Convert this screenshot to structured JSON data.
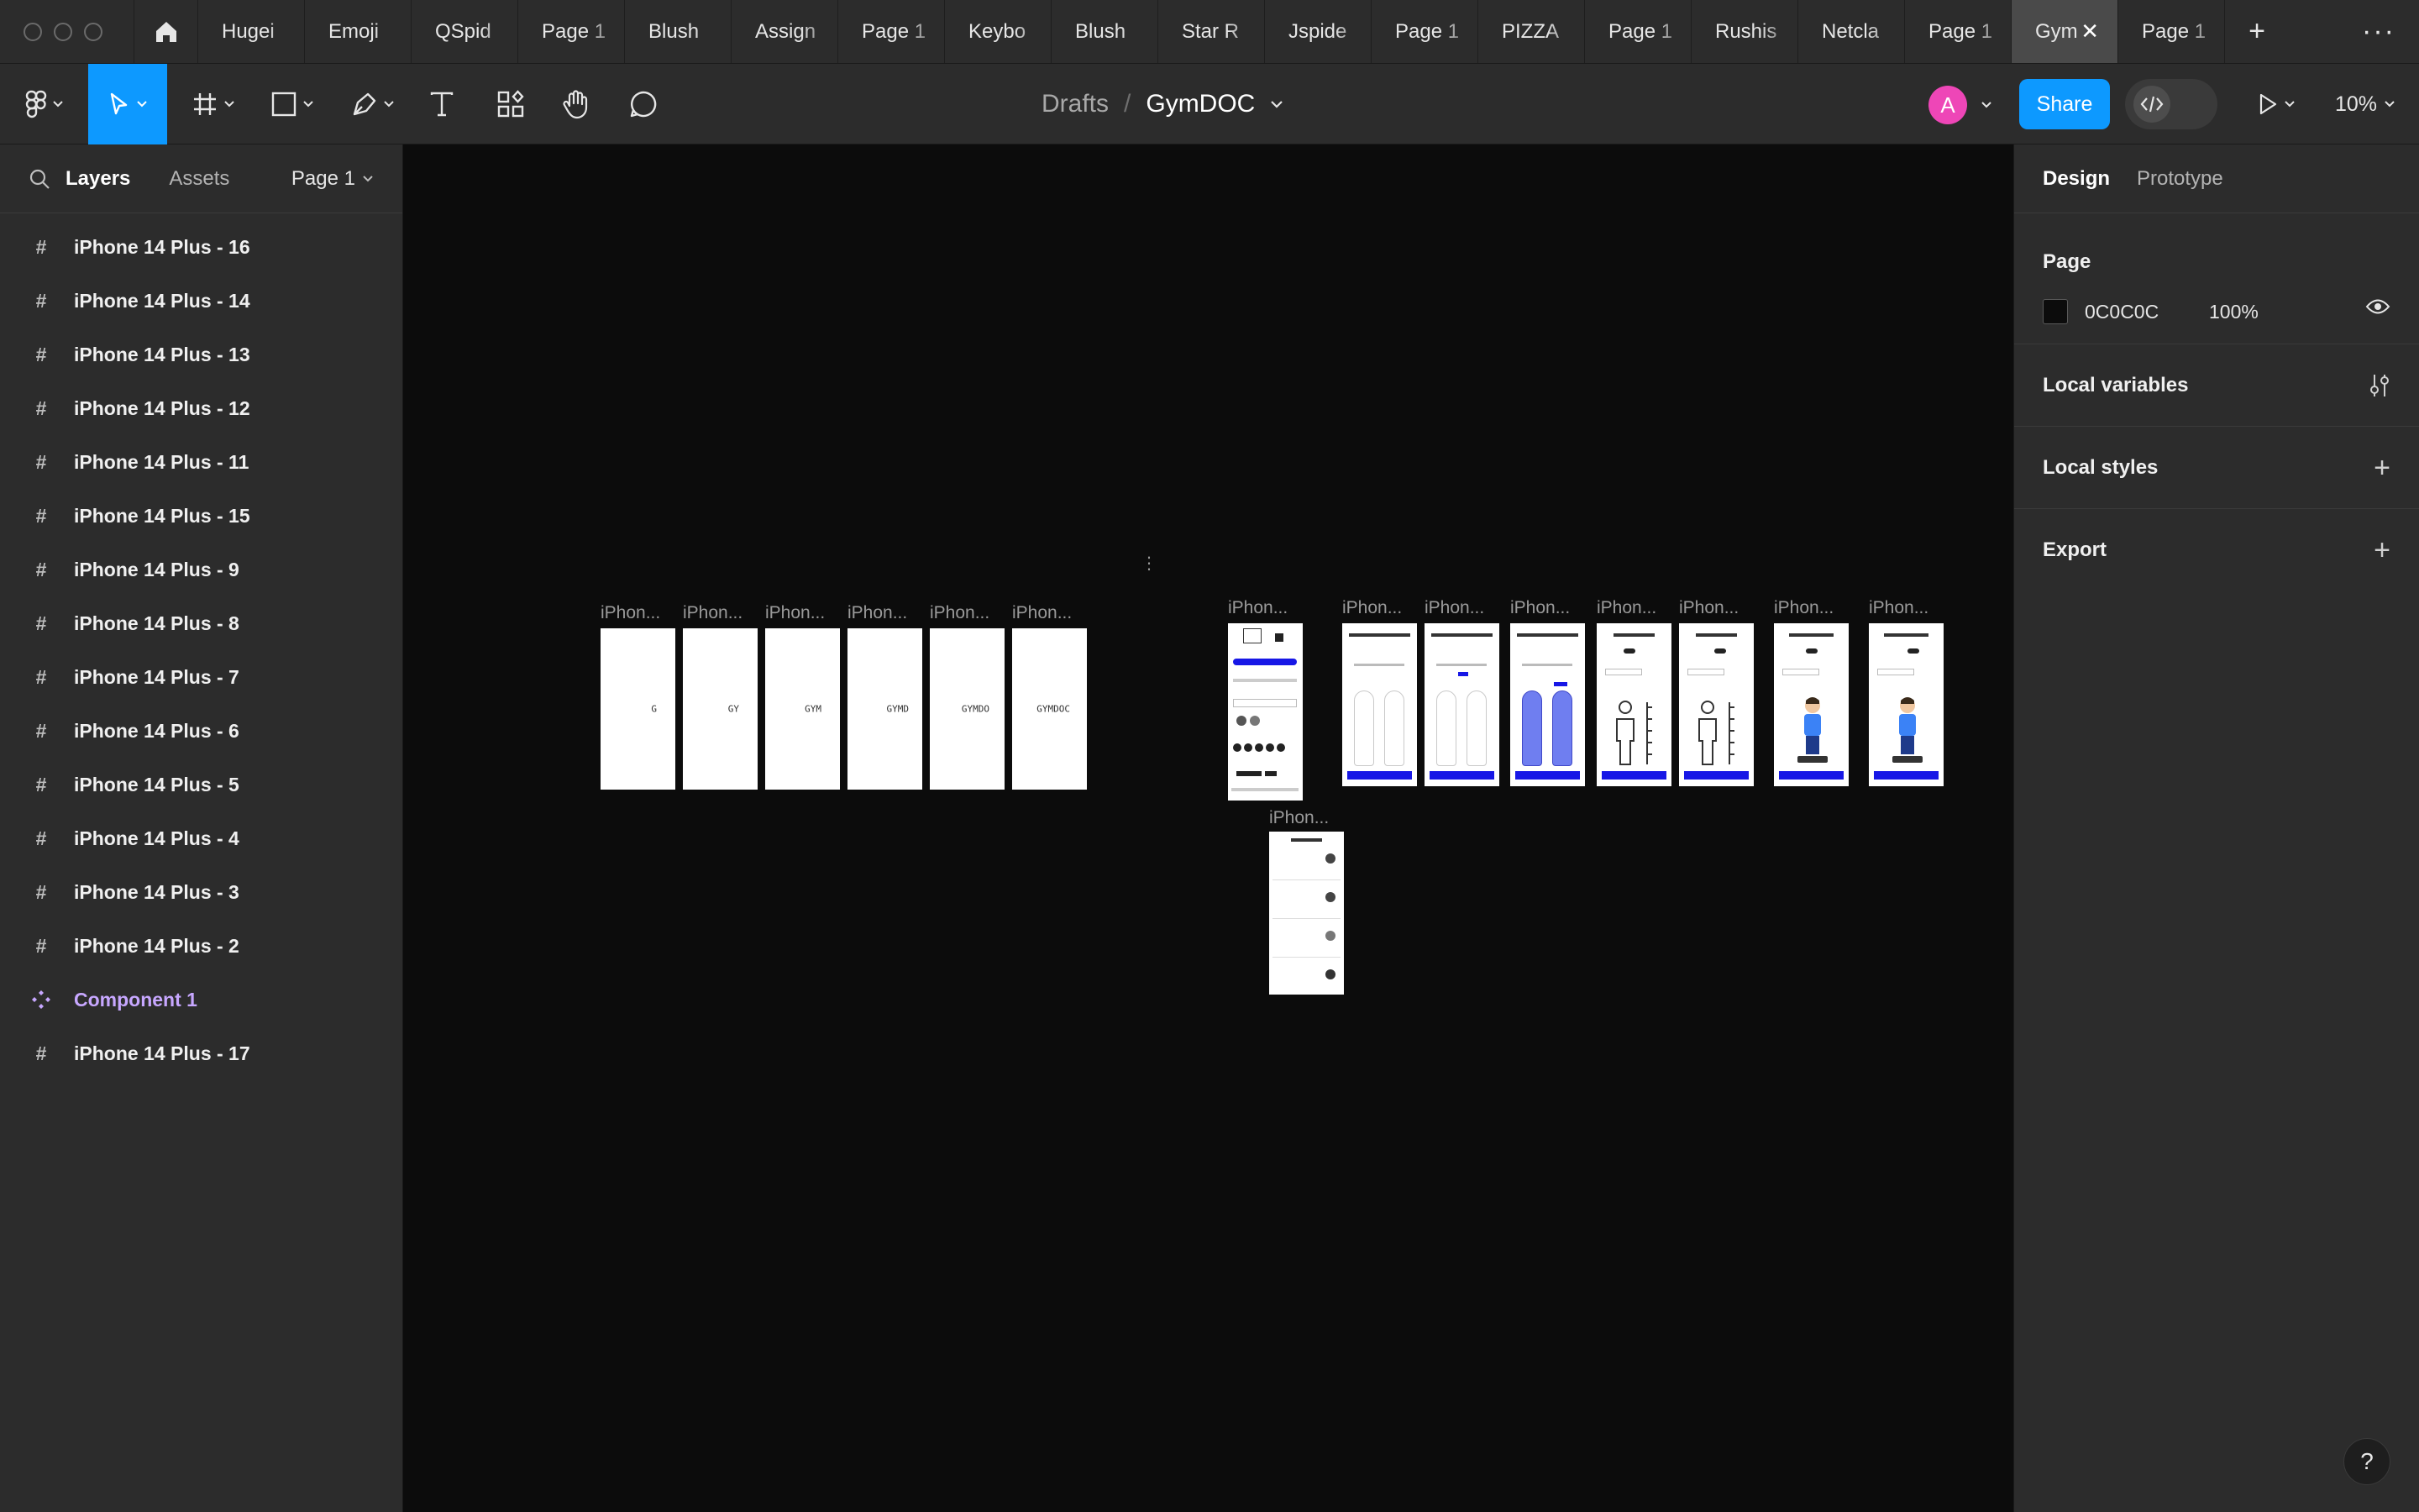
{
  "tabs": {
    "items": [
      "Hugei",
      "Emoji",
      "QSpid",
      "Page 1",
      "Blush",
      "Assign",
      "Page 1",
      "Keybo",
      "Blush",
      "Star R",
      "Jspide",
      "Page 1",
      "PIZZA",
      "Page 1",
      "Rushis",
      "Netcla",
      "Page 1",
      "Gym",
      "Page 1"
    ],
    "active_index": 17
  },
  "toolbar": {
    "breadcrumb_root": "Drafts",
    "breadcrumb_sep": "/",
    "file_name": "GymDOC",
    "avatar_initial": "A",
    "share_label": "Share",
    "zoom": "10%"
  },
  "left_panel": {
    "tab_layers": "Layers",
    "tab_assets": "Assets",
    "page_selector": "Page 1",
    "layers": [
      {
        "name": "iPhone 14 Plus - 16",
        "type": "frame"
      },
      {
        "name": "iPhone 14 Plus - 14",
        "type": "frame"
      },
      {
        "name": "iPhone 14 Plus - 13",
        "type": "frame"
      },
      {
        "name": "iPhone 14 Plus - 12",
        "type": "frame"
      },
      {
        "name": "iPhone 14 Plus - 11",
        "type": "frame"
      },
      {
        "name": "iPhone 14 Plus - 15",
        "type": "frame"
      },
      {
        "name": "iPhone 14 Plus - 9",
        "type": "frame"
      },
      {
        "name": "iPhone 14 Plus - 8",
        "type": "frame"
      },
      {
        "name": "iPhone 14 Plus - 7",
        "type": "frame"
      },
      {
        "name": "iPhone 14 Plus - 6",
        "type": "frame"
      },
      {
        "name": "iPhone 14 Plus - 5",
        "type": "frame"
      },
      {
        "name": "iPhone 14 Plus - 4",
        "type": "frame"
      },
      {
        "name": "iPhone 14 Plus - 3",
        "type": "frame"
      },
      {
        "name": "iPhone 14 Plus - 2",
        "type": "frame"
      },
      {
        "name": "Component 1",
        "type": "component"
      },
      {
        "name": "iPhone 14 Plus - 17",
        "type": "frame"
      }
    ]
  },
  "right_panel": {
    "tab_design": "Design",
    "tab_prototype": "Prototype",
    "page_title": "Page",
    "page_color": "0C0C0C",
    "page_opacity": "100%",
    "local_variables": "Local variables",
    "local_styles": "Local styles",
    "export": "Export",
    "help": "?"
  },
  "canvas": {
    "frame_label": "iPhon...",
    "splash_frames": [
      "G",
      "GY",
      "GYM",
      "GYMD",
      "GYMDO",
      "GYMDOC"
    ],
    "background_color": "#0c0c0c",
    "accent_blue": "#1717e6"
  }
}
